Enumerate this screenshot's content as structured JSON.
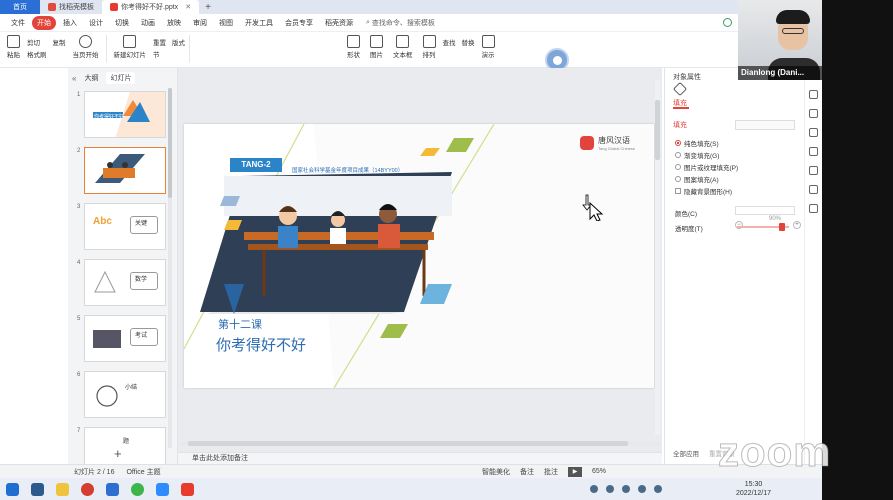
{
  "tabs": [
    {
      "label": "首页"
    },
    {
      "label": "找稻壳模板"
    },
    {
      "label": "你考得好不好.pptx"
    }
  ],
  "menu": [
    "文件",
    "开始",
    "插入",
    "设计",
    "切换",
    "动画",
    "放映",
    "审阅",
    "视图",
    "开发工具",
    "会员专享",
    "稻壳资源"
  ],
  "menu_selected": "开始",
  "search_label": "查找命令、搜索模板",
  "ribbon": {
    "paste": "粘贴",
    "cut": "剪切",
    "copy": "复制",
    "format_painter": "格式刷",
    "from_current": "当页开始",
    "new_slide": "新建幻灯片",
    "layout": "版式",
    "section": "节",
    "reset": "重置",
    "insert_shape": "形状",
    "picture": "图片",
    "textbox": "文本框",
    "arrange": "排列",
    "find": "查找",
    "replace": "替换",
    "play": "演示"
  },
  "left_panel": {
    "tab_outline": "大纲",
    "tab_slides": "幻灯片",
    "thumbs": [
      {
        "num": "1",
        "text": "你考得好不好"
      },
      {
        "num": "2",
        "text": ""
      },
      {
        "num": "3",
        "text": "关键"
      },
      {
        "num": "4",
        "text": "数学"
      },
      {
        "num": "5",
        "text": "考试"
      },
      {
        "num": "6",
        "text": "小结"
      },
      {
        "num": "7",
        "text": "题"
      }
    ],
    "add": "+"
  },
  "slide": {
    "badge": "TANG-2",
    "subtitle": "国家社会科学基金年度项目成果（14BYY00）",
    "logo_text": "唐风汉语",
    "logo_sub": "Tang Global Chinese",
    "lesson": "第十二课",
    "title": "你考得好不好"
  },
  "notes_placeholder": "单击此处添加备注",
  "right_panel": {
    "header": "对象属性",
    "fill_tab": "填充",
    "section": "填充",
    "options": [
      "纯色填充(S)",
      "渐变填充(G)",
      "图片或纹理填充(P)",
      "图案填充(A)"
    ],
    "hide_bg": "隐藏背景图形(H)",
    "color_label": "颜色(C)",
    "transparency_label": "透明度(T)",
    "transparency_value": "90%",
    "apply_all": "全部应用",
    "reset_bg": "重置背景"
  },
  "status": {
    "slide_counter": "幻灯片 2 / 16",
    "theme": "Office 主题",
    "smart": "智能美化",
    "notes": "备注",
    "comments": "批注",
    "zoom": "65%"
  },
  "taskbar": {
    "time": "15:30",
    "date": "2022/12/17"
  },
  "participant": {
    "name": "Dianlong (Dani..."
  },
  "watermark": "zoom",
  "colors": {
    "accent": "#e2443b",
    "slide_blue": "#2b84c7",
    "title_blue": "#2b6cb2"
  }
}
